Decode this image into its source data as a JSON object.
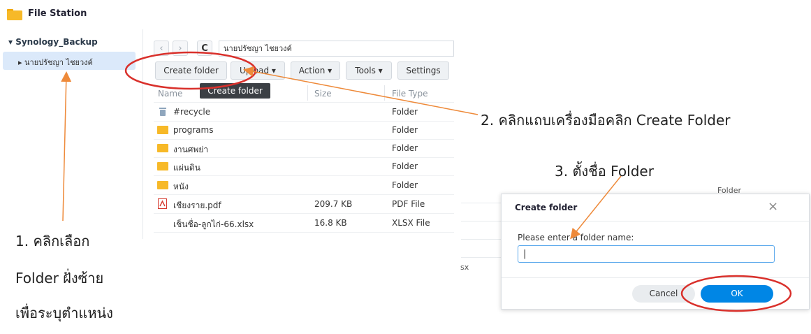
{
  "app": {
    "title": "File Station",
    "icon": "folder-icon"
  },
  "tree": {
    "root": "▾ Synology_Backup",
    "child": "▸ นายปรัชญา ไชยวงค์"
  },
  "nav": {
    "back": "‹",
    "forward": "›",
    "refresh": "C",
    "path": "นายปรัชญา ไชยวงค์"
  },
  "toolbar": {
    "create_folder": "Create folder",
    "upload": "Upload ▾",
    "action": "Action ▾",
    "tools": "Tools ▾",
    "settings": "Settings",
    "tooltip": "Create folder"
  },
  "table": {
    "columns": [
      "Name",
      "Size",
      "File Type"
    ],
    "rows": [
      {
        "name": "#recycle",
        "size": "",
        "type": "Folder",
        "icon": "recycle-bin-icon"
      },
      {
        "name": "programs",
        "size": "",
        "type": "Folder",
        "icon": "folder-icon"
      },
      {
        "name": "งานศพย่า",
        "size": "",
        "type": "Folder",
        "icon": "folder-icon"
      },
      {
        "name": "แผ่นดิน",
        "size": "",
        "type": "Folder",
        "icon": "folder-icon"
      },
      {
        "name": "หนัง",
        "size": "",
        "type": "Folder",
        "icon": "folder-icon"
      },
      {
        "name": "เชียงราย.pdf",
        "size": "209.7 KB",
        "type": "PDF File",
        "icon": "pdf-icon"
      },
      {
        "name": "เช็นชื่อ-ลูกไก่-66.xlsx",
        "size": "16.8 KB",
        "type": "XLSX File",
        "icon": "none"
      }
    ]
  },
  "behind": {
    "folder": "Folder",
    "sx": "sx"
  },
  "dialog": {
    "title": "Create folder",
    "close": "×",
    "prompt": "Please enter a folder name:",
    "input_value": "|",
    "cancel": "Cancel",
    "ok": "OK"
  },
  "annotations": {
    "step1_line1": "1. คลิกเลือก",
    "step1_line2": "Folder ฝั่งซ้าย",
    "step1_line3": "เพื่อระบุตำแหน่ง",
    "step2": "2. คลิกแถบเครื่องมือคลิก Create Folder",
    "step3": "3. ตั้งชื่อ Folder"
  },
  "colors": {
    "accent": "#0086e5",
    "highlight_circle": "#d9302b",
    "arrow": "#ee8a3a",
    "selection": "#dbe9fa",
    "folder": "#f7b928"
  }
}
